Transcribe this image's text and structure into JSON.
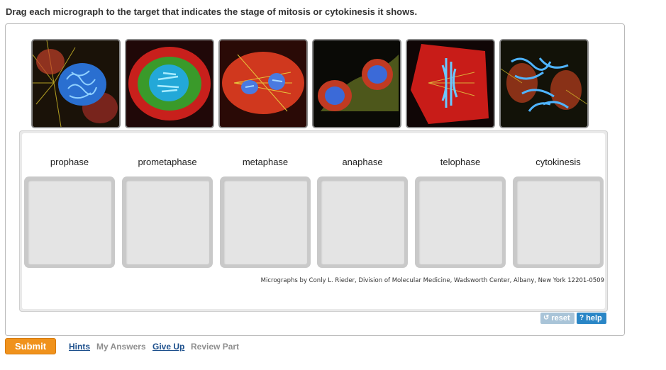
{
  "instructions": "Drag each micrograph to the target that indicates the stage of mitosis or cytokinesis it shows.",
  "micrographs": [
    {
      "name": "micrograph-1"
    },
    {
      "name": "micrograph-2"
    },
    {
      "name": "micrograph-3"
    },
    {
      "name": "micrograph-4"
    },
    {
      "name": "micrograph-5"
    },
    {
      "name": "micrograph-6"
    }
  ],
  "targets": [
    {
      "label": "prophase"
    },
    {
      "label": "prometaphase"
    },
    {
      "label": "metaphase"
    },
    {
      "label": "anaphase"
    },
    {
      "label": "telophase"
    },
    {
      "label": "cytokinesis"
    }
  ],
  "credit": "Micrographs by Conly L. Rieder, Division of Molecular Medicine, Wadsworth Center, Albany, New York 12201-0509",
  "buttons": {
    "reset": "reset",
    "help": "help",
    "submit": "Submit"
  },
  "links": {
    "hints": "Hints",
    "my_answers": "My Answers",
    "give_up": "Give Up",
    "review_part": "Review Part"
  },
  "colors": {
    "submit": "#f0921c",
    "help": "#2a86c6",
    "reset": "#a9c4d8",
    "link": "#1c4f8c"
  }
}
